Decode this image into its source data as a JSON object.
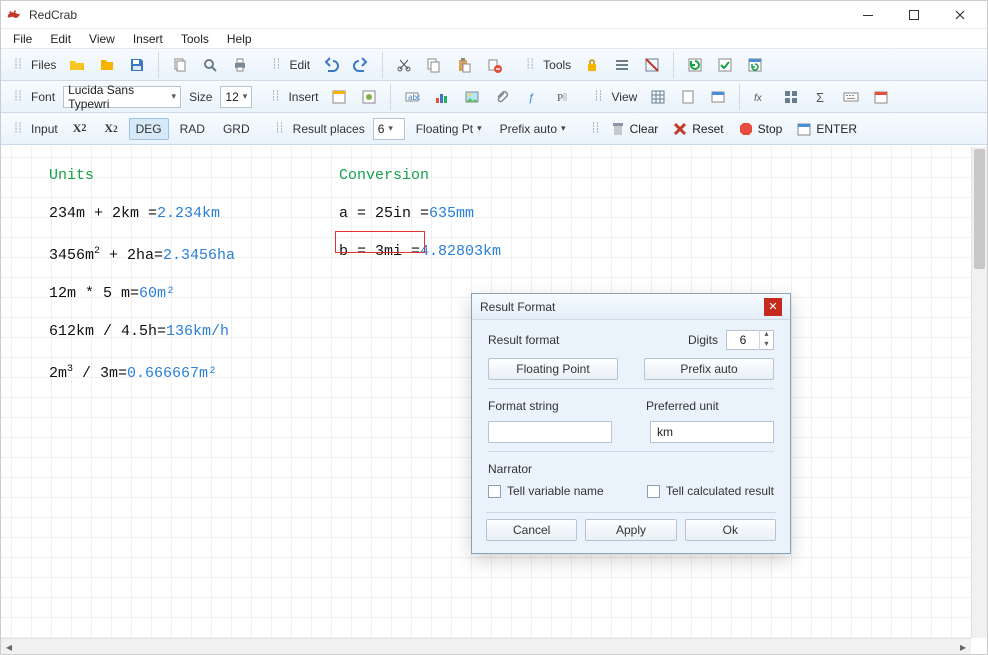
{
  "title": "RedCrab",
  "menu": [
    "File",
    "Edit",
    "View",
    "Insert",
    "Tools",
    "Help"
  ],
  "toolbar1": {
    "files_label": "Files",
    "edit_label": "Edit",
    "tools_label": "Tools"
  },
  "toolbar2": {
    "font_label": "Font",
    "font_value": "Lucida Sans Typewri",
    "size_label": "Size",
    "size_value": "12",
    "insert_label": "Insert",
    "view_label": "View"
  },
  "toolbar3": {
    "input_label": "Input",
    "angle_modes": [
      "DEG",
      "RAD",
      "GRD"
    ],
    "angle_selected": "DEG",
    "places_label": "Result places",
    "places_value": "6",
    "float_label": "Floating Pt",
    "prefix_label": "Prefix auto",
    "clear_label": "Clear",
    "reset_label": "Reset",
    "stop_label": "Stop",
    "enter_label": "ENTER"
  },
  "worksheet": {
    "left_header": "Units",
    "right_header": "Conversion",
    "left": [
      {
        "expr": "234m + 2km =",
        "res": "2.234km"
      },
      {
        "expr_html": "3456m<sup>2</sup> + 2ha=",
        "res": "2.3456ha"
      },
      {
        "expr": "12m * 5 m=",
        "res": "60m²"
      },
      {
        "expr": "612km / 4.5h=",
        "res": "136km/h"
      },
      {
        "expr_html": "2m<sup>3</sup> / 3m=",
        "res": "0.666667m²"
      }
    ],
    "right": [
      {
        "expr": "a = 25in =",
        "res": "635mm",
        "selected": false
      },
      {
        "expr": "b = 3mi =",
        "res": "4.82803km",
        "selected": true
      }
    ]
  },
  "dialog": {
    "title": "Result Format",
    "result_format_label": "Result format",
    "digits_label": "Digits",
    "digits_value": "6",
    "floating_button": "Floating Point",
    "prefix_button": "Prefix auto",
    "format_string_label": "Format string",
    "format_string_value": "",
    "preferred_unit_label": "Preferred unit",
    "preferred_unit_value": "km",
    "narrator_label": "Narrator",
    "chk_varname": "Tell variable name",
    "chk_calcres": "Tell calculated result",
    "cancel": "Cancel",
    "apply": "Apply",
    "ok": "Ok"
  }
}
